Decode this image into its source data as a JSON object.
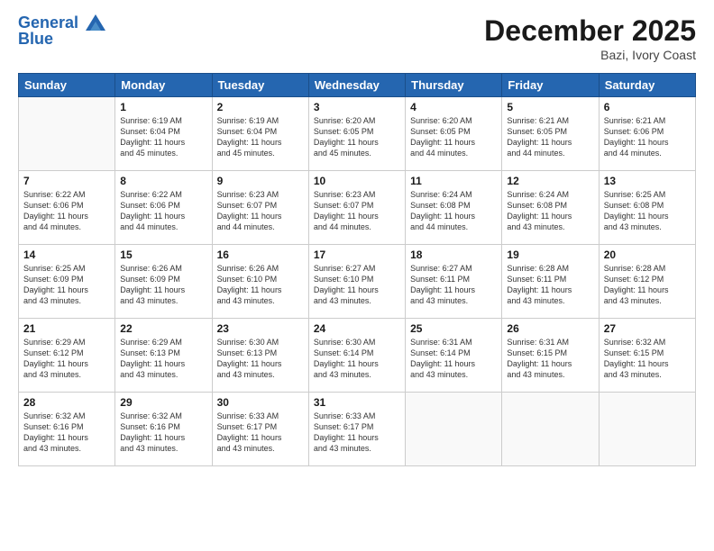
{
  "header": {
    "logo_line1": "General",
    "logo_line2": "Blue",
    "month_title": "December 2025",
    "location": "Bazi, Ivory Coast"
  },
  "weekdays": [
    "Sunday",
    "Monday",
    "Tuesday",
    "Wednesday",
    "Thursday",
    "Friday",
    "Saturday"
  ],
  "weeks": [
    [
      {
        "day": "",
        "info": ""
      },
      {
        "day": "1",
        "info": "Sunrise: 6:19 AM\nSunset: 6:04 PM\nDaylight: 11 hours\nand 45 minutes."
      },
      {
        "day": "2",
        "info": "Sunrise: 6:19 AM\nSunset: 6:04 PM\nDaylight: 11 hours\nand 45 minutes."
      },
      {
        "day": "3",
        "info": "Sunrise: 6:20 AM\nSunset: 6:05 PM\nDaylight: 11 hours\nand 45 minutes."
      },
      {
        "day": "4",
        "info": "Sunrise: 6:20 AM\nSunset: 6:05 PM\nDaylight: 11 hours\nand 44 minutes."
      },
      {
        "day": "5",
        "info": "Sunrise: 6:21 AM\nSunset: 6:05 PM\nDaylight: 11 hours\nand 44 minutes."
      },
      {
        "day": "6",
        "info": "Sunrise: 6:21 AM\nSunset: 6:06 PM\nDaylight: 11 hours\nand 44 minutes."
      }
    ],
    [
      {
        "day": "7",
        "info": "Sunrise: 6:22 AM\nSunset: 6:06 PM\nDaylight: 11 hours\nand 44 minutes."
      },
      {
        "day": "8",
        "info": "Sunrise: 6:22 AM\nSunset: 6:06 PM\nDaylight: 11 hours\nand 44 minutes."
      },
      {
        "day": "9",
        "info": "Sunrise: 6:23 AM\nSunset: 6:07 PM\nDaylight: 11 hours\nand 44 minutes."
      },
      {
        "day": "10",
        "info": "Sunrise: 6:23 AM\nSunset: 6:07 PM\nDaylight: 11 hours\nand 44 minutes."
      },
      {
        "day": "11",
        "info": "Sunrise: 6:24 AM\nSunset: 6:08 PM\nDaylight: 11 hours\nand 44 minutes."
      },
      {
        "day": "12",
        "info": "Sunrise: 6:24 AM\nSunset: 6:08 PM\nDaylight: 11 hours\nand 43 minutes."
      },
      {
        "day": "13",
        "info": "Sunrise: 6:25 AM\nSunset: 6:08 PM\nDaylight: 11 hours\nand 43 minutes."
      }
    ],
    [
      {
        "day": "14",
        "info": "Sunrise: 6:25 AM\nSunset: 6:09 PM\nDaylight: 11 hours\nand 43 minutes."
      },
      {
        "day": "15",
        "info": "Sunrise: 6:26 AM\nSunset: 6:09 PM\nDaylight: 11 hours\nand 43 minutes."
      },
      {
        "day": "16",
        "info": "Sunrise: 6:26 AM\nSunset: 6:10 PM\nDaylight: 11 hours\nand 43 minutes."
      },
      {
        "day": "17",
        "info": "Sunrise: 6:27 AM\nSunset: 6:10 PM\nDaylight: 11 hours\nand 43 minutes."
      },
      {
        "day": "18",
        "info": "Sunrise: 6:27 AM\nSunset: 6:11 PM\nDaylight: 11 hours\nand 43 minutes."
      },
      {
        "day": "19",
        "info": "Sunrise: 6:28 AM\nSunset: 6:11 PM\nDaylight: 11 hours\nand 43 minutes."
      },
      {
        "day": "20",
        "info": "Sunrise: 6:28 AM\nSunset: 6:12 PM\nDaylight: 11 hours\nand 43 minutes."
      }
    ],
    [
      {
        "day": "21",
        "info": "Sunrise: 6:29 AM\nSunset: 6:12 PM\nDaylight: 11 hours\nand 43 minutes."
      },
      {
        "day": "22",
        "info": "Sunrise: 6:29 AM\nSunset: 6:13 PM\nDaylight: 11 hours\nand 43 minutes."
      },
      {
        "day": "23",
        "info": "Sunrise: 6:30 AM\nSunset: 6:13 PM\nDaylight: 11 hours\nand 43 minutes."
      },
      {
        "day": "24",
        "info": "Sunrise: 6:30 AM\nSunset: 6:14 PM\nDaylight: 11 hours\nand 43 minutes."
      },
      {
        "day": "25",
        "info": "Sunrise: 6:31 AM\nSunset: 6:14 PM\nDaylight: 11 hours\nand 43 minutes."
      },
      {
        "day": "26",
        "info": "Sunrise: 6:31 AM\nSunset: 6:15 PM\nDaylight: 11 hours\nand 43 minutes."
      },
      {
        "day": "27",
        "info": "Sunrise: 6:32 AM\nSunset: 6:15 PM\nDaylight: 11 hours\nand 43 minutes."
      }
    ],
    [
      {
        "day": "28",
        "info": "Sunrise: 6:32 AM\nSunset: 6:16 PM\nDaylight: 11 hours\nand 43 minutes."
      },
      {
        "day": "29",
        "info": "Sunrise: 6:32 AM\nSunset: 6:16 PM\nDaylight: 11 hours\nand 43 minutes."
      },
      {
        "day": "30",
        "info": "Sunrise: 6:33 AM\nSunset: 6:17 PM\nDaylight: 11 hours\nand 43 minutes."
      },
      {
        "day": "31",
        "info": "Sunrise: 6:33 AM\nSunset: 6:17 PM\nDaylight: 11 hours\nand 43 minutes."
      },
      {
        "day": "",
        "info": ""
      },
      {
        "day": "",
        "info": ""
      },
      {
        "day": "",
        "info": ""
      }
    ]
  ]
}
